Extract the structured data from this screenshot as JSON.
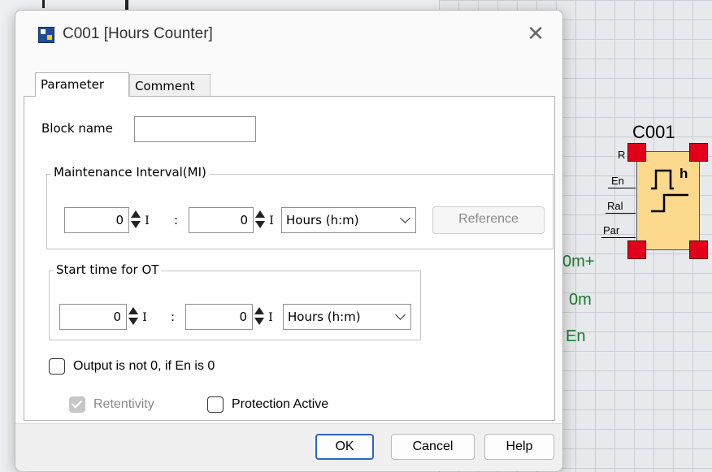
{
  "dialog": {
    "title": "C001 [Hours Counter]",
    "close_symbol": "✕",
    "icon": "app-block-icon"
  },
  "tabs": [
    {
      "label": "Parameter",
      "active": true
    },
    {
      "label": "Comment",
      "active": false
    }
  ],
  "block_name": {
    "label": "Block name",
    "value": ""
  },
  "maintenance": {
    "group_label": "Maintenance Interval(MI)",
    "hours_value": "0",
    "minutes_value": "0",
    "i_label": "I",
    "colon": ":",
    "unit": "Hours (h:m)",
    "reference_label": "Reference"
  },
  "start_time": {
    "group_label": "Start time for OT",
    "hours_value": "0",
    "minutes_value": "0",
    "i_label": "I",
    "colon": ":",
    "unit": "Hours (h:m)"
  },
  "checkboxes": {
    "output_not_zero": {
      "label": "Output is not 0, if En is 0",
      "checked": false
    },
    "retentivity": {
      "label": "Retentivity",
      "checked": true,
      "disabled": true
    },
    "protection": {
      "label": "Protection Active",
      "checked": false
    }
  },
  "buttons": {
    "ok": "OK",
    "cancel": "Cancel",
    "help": "Help"
  },
  "background_block": {
    "name": "C001",
    "inputs": [
      "R",
      "En",
      "Ral",
      "Par"
    ],
    "symbol_text": "h",
    "side_text": [
      "0m+",
      "0m",
      "En"
    ],
    "colors": {
      "block_fill": "#fcd98d",
      "pin": "#e0001a",
      "side_text": "#1a7a2a"
    }
  }
}
